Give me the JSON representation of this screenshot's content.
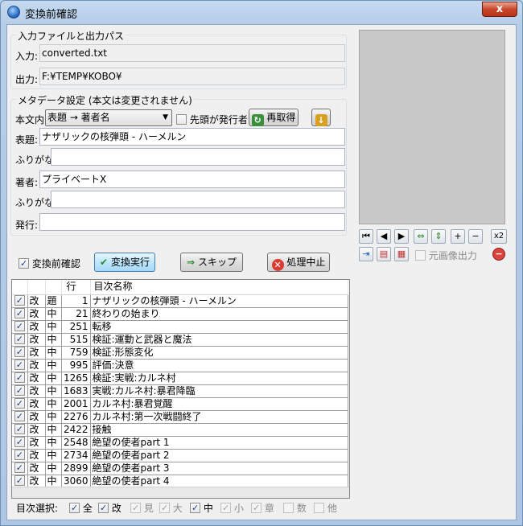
{
  "window": {
    "title": "変換前確認",
    "close_label": "x"
  },
  "io_group": {
    "title": "入力ファイルと出力パス",
    "input_label": "入力:",
    "input_value": "converted.txt",
    "output_label": "出力:",
    "output_value": "F:¥TEMP¥KOBO¥"
  },
  "meta_group": {
    "title": "メタデータ設定 (本文は変更されません)",
    "body_label": "本文内",
    "body_select": "表題 → 著者名",
    "first_publisher_label": "先頭が発行者",
    "reload_label": "再取得",
    "title_label": "表題:",
    "title_value": "ナザリックの核弾頭 - ハーメルン",
    "title_kana_label": "ふりがな:",
    "title_kana_value": "",
    "author_label": "著者:",
    "author_value": "プライベートX",
    "author_kana_label": "ふりがな:",
    "author_kana_value": "",
    "publisher_label": "発行:",
    "publisher_value": ""
  },
  "preview_tools": {
    "x2_label": "x2",
    "original_image_label": "元画像出力"
  },
  "actions": {
    "pre_confirm_label": "変換前確認",
    "convert_label": "変換実行",
    "skip_label": "スキップ",
    "abort_label": "処理中止"
  },
  "toc": {
    "columns": [
      "",
      "",
      "",
      "行",
      "目次名称"
    ],
    "rows": [
      {
        "checked": true,
        "type": "改",
        "level": "題",
        "line": "1",
        "name": "ナザリックの核弾頭 - ハーメルン"
      },
      {
        "checked": true,
        "type": "改",
        "level": "中",
        "line": "21",
        "name": "終わりの始まり"
      },
      {
        "checked": true,
        "type": "改",
        "level": "中",
        "line": "251",
        "name": "転移"
      },
      {
        "checked": true,
        "type": "改",
        "level": "中",
        "line": "515",
        "name": "検証:運動と武器と魔法"
      },
      {
        "checked": true,
        "type": "改",
        "level": "中",
        "line": "759",
        "name": "検証:形態変化"
      },
      {
        "checked": true,
        "type": "改",
        "level": "中",
        "line": "995",
        "name": "評価:決意"
      },
      {
        "checked": true,
        "type": "改",
        "level": "中",
        "line": "1265",
        "name": "検証:実戦:カルネ村"
      },
      {
        "checked": true,
        "type": "改",
        "level": "中",
        "line": "1683",
        "name": "実戦:カルネ村:暴君降臨"
      },
      {
        "checked": true,
        "type": "改",
        "level": "中",
        "line": "2001",
        "name": "カルネ村:暴君覚醒"
      },
      {
        "checked": true,
        "type": "改",
        "level": "中",
        "line": "2276",
        "name": "カルネ村:第一次戦闘終了"
      },
      {
        "checked": true,
        "type": "改",
        "level": "中",
        "line": "2422",
        "name": "接触"
      },
      {
        "checked": true,
        "type": "改",
        "level": "中",
        "line": "2548",
        "name": "絶望の使者part 1"
      },
      {
        "checked": true,
        "type": "改",
        "level": "中",
        "line": "2734",
        "name": "絶望の使者part 2"
      },
      {
        "checked": true,
        "type": "改",
        "level": "中",
        "line": "2899",
        "name": "絶望の使者part 3"
      },
      {
        "checked": true,
        "type": "改",
        "level": "中",
        "line": "3060",
        "name": "絶望の使者part 4"
      }
    ]
  },
  "toc_filter": {
    "label": "目次選択:",
    "items": [
      {
        "label": "全",
        "checked": true,
        "enabled": true
      },
      {
        "label": "改",
        "checked": true,
        "enabled": true
      },
      {
        "label": "見",
        "checked": true,
        "enabled": false
      },
      {
        "label": "大",
        "checked": true,
        "enabled": false
      },
      {
        "label": "中",
        "checked": true,
        "enabled": true
      },
      {
        "label": "小",
        "checked": true,
        "enabled": false
      },
      {
        "label": "章",
        "checked": true,
        "enabled": false
      },
      {
        "label": "数",
        "checked": false,
        "enabled": false
      },
      {
        "label": "他",
        "checked": false,
        "enabled": false
      }
    ]
  }
}
